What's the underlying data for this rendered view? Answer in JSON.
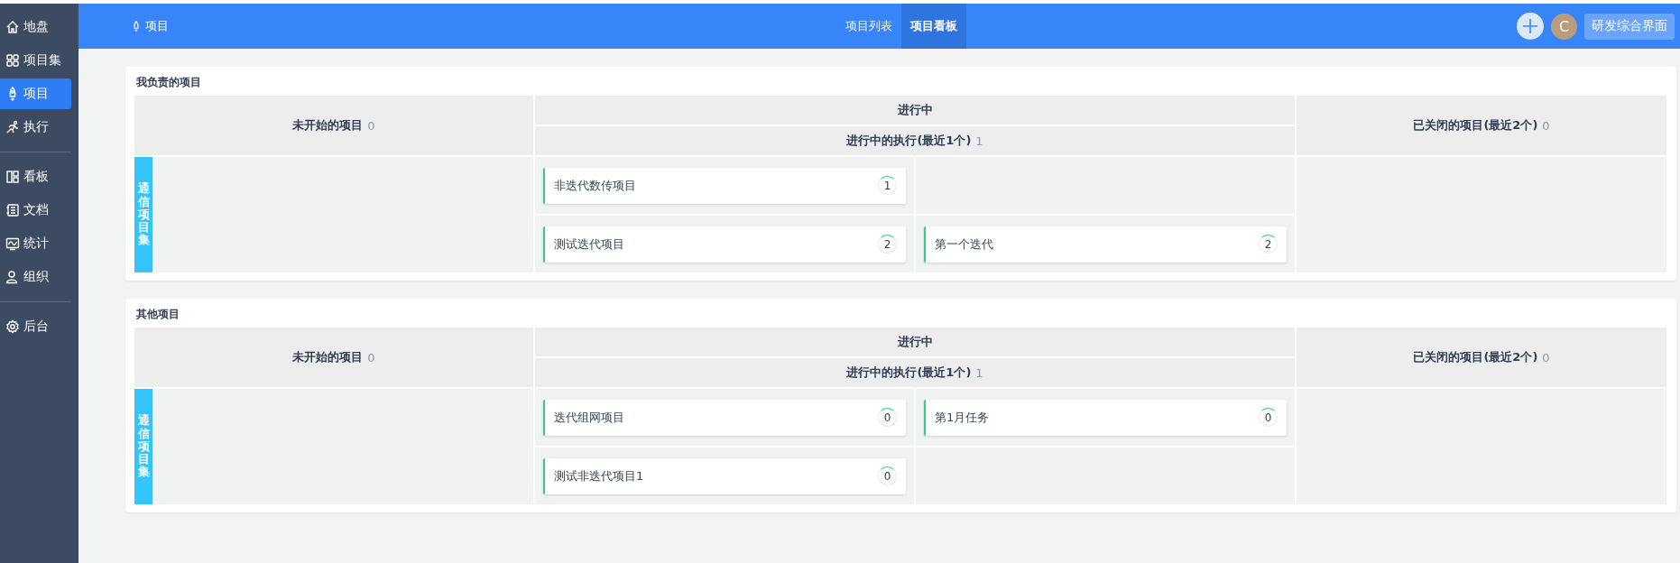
{
  "sidebar": {
    "items": [
      {
        "label": "地盘",
        "selected": false,
        "divider_after": false
      },
      {
        "label": "项目集",
        "selected": false,
        "divider_after": false
      },
      {
        "label": "项目",
        "selected": true,
        "divider_after": false
      },
      {
        "label": "执行",
        "selected": false,
        "divider_after": true
      },
      {
        "label": "看板",
        "selected": false,
        "divider_after": false
      },
      {
        "label": "文档",
        "selected": false,
        "divider_after": false
      },
      {
        "label": "统计",
        "selected": false,
        "divider_after": false
      },
      {
        "label": "组织",
        "selected": false,
        "divider_after": true
      },
      {
        "label": "后台",
        "selected": false,
        "divider_after": false
      }
    ]
  },
  "header": {
    "breadcrumb": "项目",
    "tabs": [
      {
        "label": "项目列表",
        "selected": false
      },
      {
        "label": "项目看板",
        "selected": true
      }
    ],
    "avatar": "C",
    "button": "研发综合界面"
  },
  "sections": [
    {
      "title": "我负责的项目",
      "columns": {
        "waiting": "未开始的项目",
        "waiting_count": "0",
        "ongoing": "进行中",
        "ongoing_sub": "进行中的执行(最近1个)",
        "ongoing_sub_count": "1",
        "closed": "已关闭的项目(最近2个)",
        "closed_count": "0"
      },
      "group": "通信项目集",
      "rows": [
        {
          "project": {
            "name": "非迭代数传项目",
            "count": "1"
          }
        },
        {
          "project": {
            "name": "测试迭代项目",
            "count": "2"
          },
          "execution": {
            "name": "第一个迭代",
            "count": "2"
          }
        }
      ]
    },
    {
      "title": "其他项目",
      "columns": {
        "waiting": "未开始的项目",
        "waiting_count": "0",
        "ongoing": "进行中",
        "ongoing_sub": "进行中的执行(最近1个)",
        "ongoing_sub_count": "1",
        "closed": "已关闭的项目(最近2个)",
        "closed_count": "0"
      },
      "group": "通信项目集",
      "rows": [
        {
          "project": {
            "name": "迭代组网项目",
            "count": "0"
          },
          "execution": {
            "name": "第1月任务",
            "count": "0"
          }
        },
        {
          "project": {
            "name": "测试非迭代项目1",
            "count": "0"
          }
        }
      ]
    }
  ]
}
